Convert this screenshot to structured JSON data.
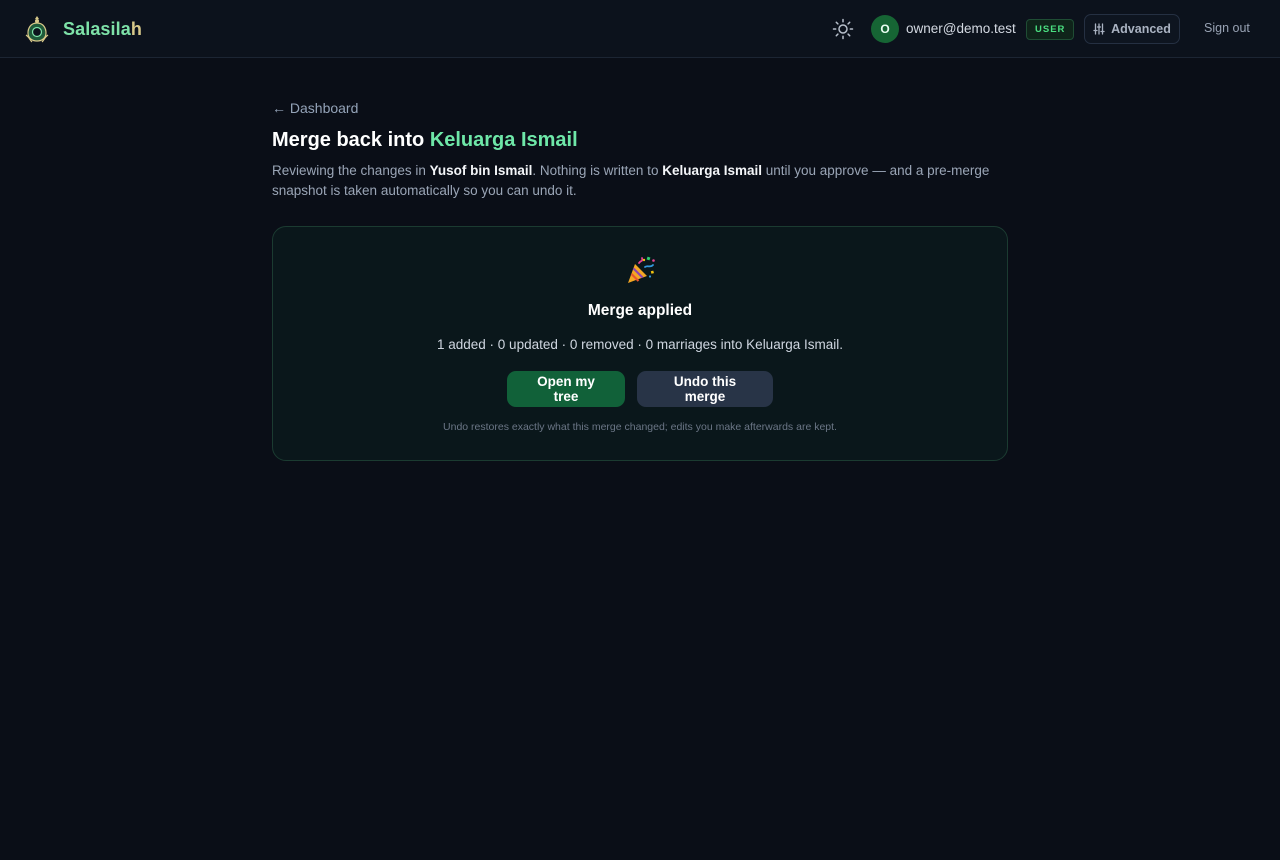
{
  "app": {
    "name_part1": "Salasila",
    "name_part2": "h"
  },
  "header": {
    "avatar_letter": "O",
    "email": "owner@demo.test",
    "role_badge": "USER",
    "advanced_label": "Advanced",
    "signout_label": "Sign out"
  },
  "page": {
    "back_label": "← Dashboard",
    "title_prefix": "Merge back into ",
    "title_target": "Keluarga Ismail",
    "desc_1": "Reviewing the changes in ",
    "desc_source": "Yusof bin Ismail",
    "desc_2": ". Nothing is written to ",
    "desc_target": "Keluarga Ismail",
    "desc_3": " until you approve — and a pre-merge snapshot is taken automatically so you can undo it."
  },
  "result": {
    "title": "Merge applied",
    "summary": "1 added · 0 updated · 0 removed · 0 marriages into Keluarga Ismail.",
    "open_button": "Open my tree",
    "undo_button": "Undo this merge",
    "note": "Undo restores exactly what this merge changed; edits you make afterwards are kept."
  },
  "icons": {
    "logo": "family-crest-icon",
    "theme": "sun-icon",
    "advanced": "sliders-icon",
    "celebration": "party-popper-icon"
  },
  "colors": {
    "accent": "#6ee7a8",
    "primary_button": "#116139",
    "background": "#0a0e17"
  }
}
